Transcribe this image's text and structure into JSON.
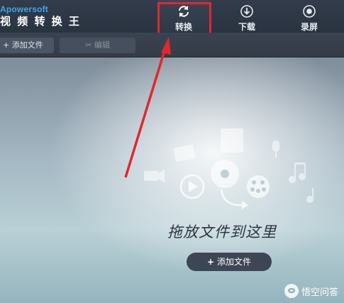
{
  "header": {
    "brand": "Apowersoft",
    "app_title": "视 频 转 换 王",
    "tabs": [
      {
        "label": "转换",
        "icon": "refresh-icon"
      },
      {
        "label": "下载",
        "icon": "download-icon"
      },
      {
        "label": "录屏",
        "icon": "record-icon"
      }
    ]
  },
  "toolbar": {
    "add_file_label": "添加文件",
    "edit_label": "编辑"
  },
  "dropzone": {
    "hint": "拖放文件到这里",
    "add_file_label": "添加文件"
  },
  "annotation": {
    "highlight_color": "#e0282e"
  },
  "watermark": {
    "text": "悟空问答"
  },
  "colors": {
    "brand": "#3ea6f0",
    "topbar": "#2a3340",
    "pill": "#3d4654"
  }
}
